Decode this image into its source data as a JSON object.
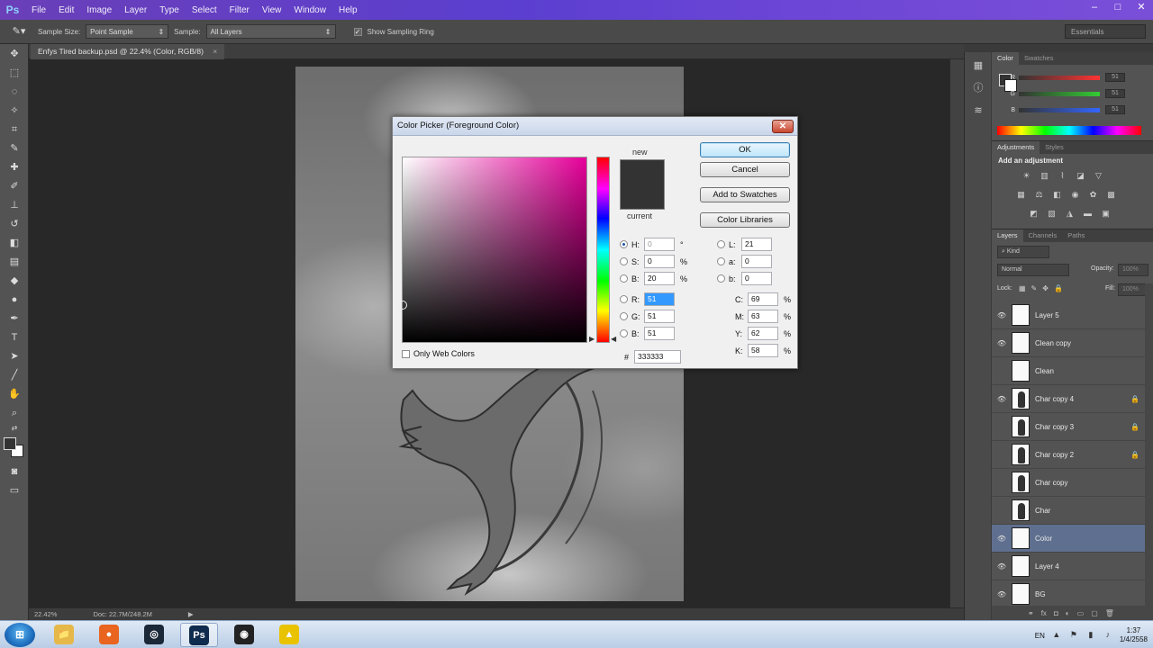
{
  "app": {
    "logo": "Ps",
    "menu": [
      "File",
      "Edit",
      "Image",
      "Layer",
      "Type",
      "Select",
      "Filter",
      "View",
      "Window",
      "Help"
    ],
    "window_controls": [
      "–",
      "□",
      "✕"
    ]
  },
  "options_bar": {
    "sample_size_label": "Sample Size:",
    "sample_size_value": "Point Sample",
    "sample_label": "Sample:",
    "sample_value": "All Layers",
    "sampling_ring_label": "Show Sampling Ring",
    "workspace": "Essentials"
  },
  "document": {
    "tab_title": "Enfys Tired backup.psd @ 22.4% (Color, RGB/8)",
    "zoom": "22.42%",
    "doc_size": "Doc: 22.7M/248.2M"
  },
  "color_panel": {
    "tabs": [
      "Color",
      "Swatches"
    ],
    "sliders": [
      {
        "label": "R",
        "gradient": "#ff3333",
        "value": "51"
      },
      {
        "label": "G",
        "gradient": "#33cc33",
        "value": "51"
      },
      {
        "label": "B",
        "gradient": "#3366ff",
        "value": "51"
      }
    ]
  },
  "adjustments_panel": {
    "tabs": [
      "Adjustments",
      "Styles"
    ],
    "title": "Add an adjustment"
  },
  "layers_panel": {
    "tabs": [
      "Layers",
      "Channels",
      "Paths"
    ],
    "kind_label": "Kind",
    "blend_mode": "Normal",
    "opacity_label": "Opacity:",
    "opacity_value": "100%",
    "lock_label": "Lock:",
    "fill_label": "Fill:",
    "fill_value": "100%",
    "layers": [
      {
        "name": "Layer 5",
        "visible": true,
        "locked": false,
        "selected": false
      },
      {
        "name": "Clean copy",
        "visible": true,
        "locked": false,
        "selected": false
      },
      {
        "name": "Clean",
        "visible": false,
        "locked": false,
        "selected": false
      },
      {
        "name": "Char copy 4",
        "visible": true,
        "locked": true,
        "selected": false
      },
      {
        "name": "Char copy 3",
        "visible": false,
        "locked": true,
        "selected": false
      },
      {
        "name": "Char copy 2",
        "visible": false,
        "locked": true,
        "selected": false
      },
      {
        "name": "Char copy",
        "visible": false,
        "locked": false,
        "selected": false
      },
      {
        "name": "Char",
        "visible": false,
        "locked": false,
        "selected": false
      },
      {
        "name": "Color",
        "visible": true,
        "locked": false,
        "selected": true
      },
      {
        "name": "Layer 4",
        "visible": true,
        "locked": false,
        "selected": false
      },
      {
        "name": "BG",
        "visible": true,
        "locked": false,
        "selected": false
      }
    ]
  },
  "color_picker": {
    "title": "Color Picker (Foreground Color)",
    "close_glyph": "✕",
    "new_label": "new",
    "current_label": "current",
    "new_color": "#333333",
    "current_color": "#333333",
    "buttons": {
      "ok": "OK",
      "cancel": "Cancel",
      "add_swatches": "Add to Swatches",
      "color_libraries": "Color Libraries"
    },
    "hsb": [
      {
        "label": "H:",
        "value": "0",
        "unit": "°",
        "selected": true
      },
      {
        "label": "S:",
        "value": "0",
        "unit": "%",
        "selected": false
      },
      {
        "label": "B:",
        "value": "20",
        "unit": "%",
        "selected": false
      }
    ],
    "rgb": [
      {
        "label": "R:",
        "value": "51",
        "selected": false
      },
      {
        "label": "G:",
        "value": "51",
        "selected": false
      },
      {
        "label": "B:",
        "value": "51",
        "selected": false
      }
    ],
    "lab": [
      {
        "label": "L:",
        "value": "21"
      },
      {
        "label": "a:",
        "value": "0"
      },
      {
        "label": "b:",
        "value": "0"
      }
    ],
    "cmyk": [
      {
        "label": "C:",
        "value": "69",
        "unit": "%"
      },
      {
        "label": "M:",
        "value": "63",
        "unit": "%"
      },
      {
        "label": "Y:",
        "value": "62",
        "unit": "%"
      },
      {
        "label": "K:",
        "value": "58",
        "unit": "%"
      }
    ],
    "web_colors_label": "Only Web Colors",
    "hex_label": "#",
    "hex_value": "333333"
  },
  "taskbar": {
    "start_glyph": "⊞",
    "apps": [
      {
        "name": "explorer",
        "glyph": "📁",
        "color": "#e6b84a"
      },
      {
        "name": "firefox",
        "glyph": "●",
        "color": "#e8641f"
      },
      {
        "name": "steam",
        "glyph": "◎",
        "color": "#1b2838"
      },
      {
        "name": "photoshop",
        "glyph": "Ps",
        "color": "#0f2b4d"
      },
      {
        "name": "obs",
        "glyph": "◉",
        "color": "#222222"
      },
      {
        "name": "norton",
        "glyph": "▲",
        "color": "#e9c200"
      }
    ],
    "language": "EN",
    "time": "1:37",
    "date": "1/4/2558"
  }
}
